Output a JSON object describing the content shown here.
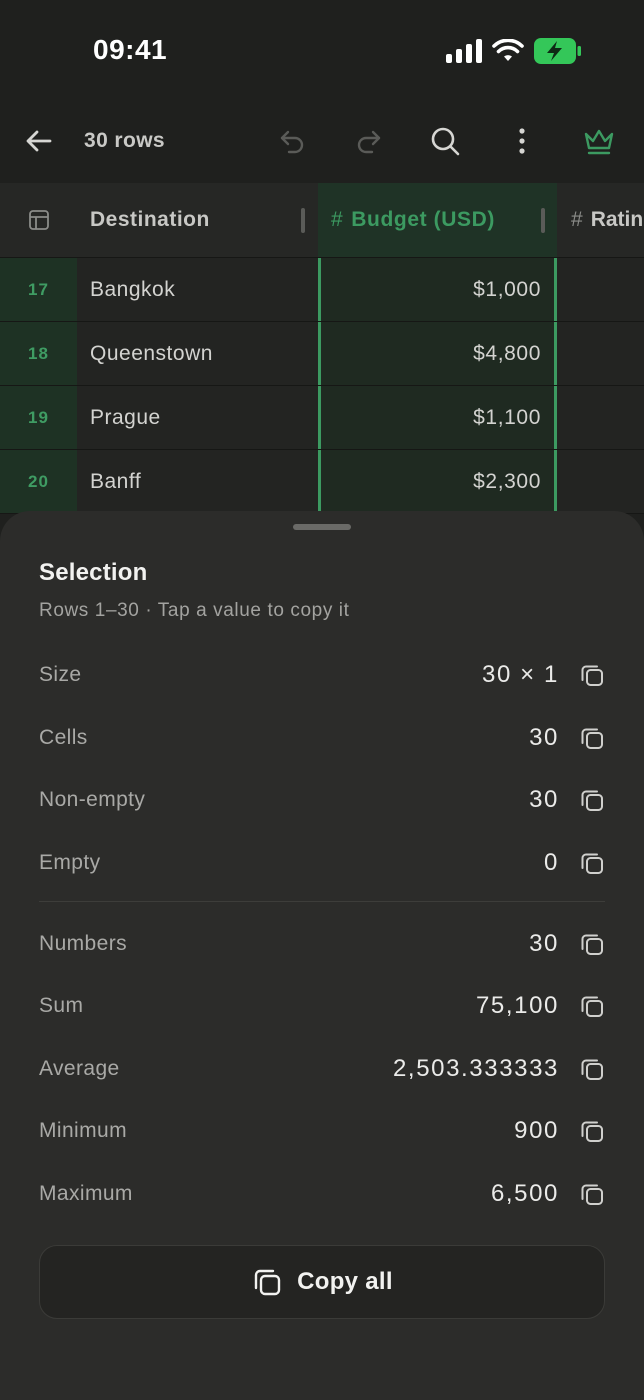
{
  "status_bar": {
    "time": "09:41",
    "icons": [
      "signal-icon",
      "wifi-icon",
      "battery-charging-icon"
    ],
    "battery_color": "#34c759"
  },
  "toolbar": {
    "title": "30 rows",
    "icons": [
      "back-arrow-icon",
      "undo-icon",
      "redo-icon",
      "search-icon",
      "more-vertical-icon",
      "crown-icon"
    ],
    "accent": "#3c9a61"
  },
  "grid": {
    "index_icon": "table-icon",
    "columns": [
      {
        "label": "Destination"
      },
      {
        "label": "Budget (USD)",
        "type_prefix": "#",
        "selected": true
      },
      {
        "label": "Ratin",
        "type_prefix": "#"
      }
    ],
    "rows": [
      {
        "index": "17",
        "destination": "Bangkok",
        "budget": "$1,000"
      },
      {
        "index": "18",
        "destination": "Queenstown",
        "budget": "$4,800"
      },
      {
        "index": "19",
        "destination": "Prague",
        "budget": "$1,100"
      },
      {
        "index": "20",
        "destination": "Banff",
        "budget": "$2,300"
      }
    ]
  },
  "sheet": {
    "title": "Selection",
    "subtitle": "Rows 1–30 · Tap a value to copy it",
    "stats": [
      {
        "label": "Size",
        "value": "30 × 1"
      },
      {
        "label": "Cells",
        "value": "30"
      },
      {
        "label": "Non-empty",
        "value": "30"
      },
      {
        "label": "Empty",
        "value": "0"
      },
      {
        "label": "Numbers",
        "value": "30"
      },
      {
        "label": "Sum",
        "value": "75,100"
      },
      {
        "label": "Average",
        "value": "2,503.333333"
      },
      {
        "label": "Minimum",
        "value": "900"
      },
      {
        "label": "Maximum",
        "value": "6,500"
      }
    ],
    "copy_icon": "copy-icon",
    "copy_all_label": "Copy all"
  }
}
